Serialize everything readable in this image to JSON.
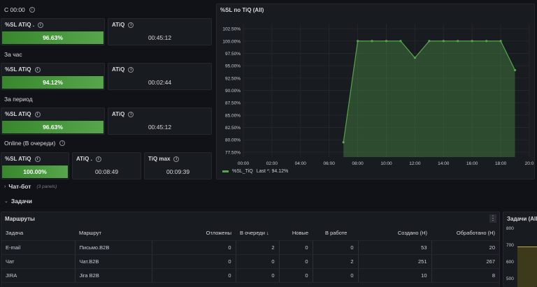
{
  "sections": {
    "s1": "С 00:00",
    "s2": "За час",
    "s3": "За период",
    "s4": "Online (В очереди)"
  },
  "stats": {
    "r1": {
      "sl_title": "%SL ATiQ .",
      "sl_value": "96.63%",
      "sl_fill": 0.9663,
      "at_title": "ATiQ",
      "at_value": "00:45:12"
    },
    "r2": {
      "sl_title": "%SL ATiQ",
      "sl_value": "94.12%",
      "sl_fill": 0.9412,
      "at_title": "ATiQ",
      "at_value": "00:02:44"
    },
    "r3": {
      "sl_title": "%SL ATiQ",
      "sl_value": "96.63%",
      "sl_fill": 0.9663,
      "at_title": "ATiQ",
      "at_value": "00:45:12"
    },
    "r4": {
      "sl_title": "%SL ATiQ",
      "sl_value": "100.00%",
      "sl_fill": 1.0,
      "at_title": "ATiQ .",
      "at_value": "00:08:49",
      "max_title": "TiQ max",
      "max_value": "00:09:39"
    }
  },
  "rows": {
    "chatbot": "Чат-бот",
    "chatbot_note": "(3 panels)",
    "tasks": "Задачи"
  },
  "chart_data": {
    "type": "area",
    "title": "%SL по TiQ (All)",
    "x": [
      "06:50",
      "07:30",
      "08:00",
      "08:30",
      "09:00",
      "09:30",
      "10:00",
      "10:30",
      "11:00",
      "11:30",
      "12:00",
      "12:30",
      "13:00",
      "13:30",
      "14:00",
      "14:30",
      "15:00",
      "15:30",
      "16:00",
      "16:30",
      "17:00",
      "17:30",
      "18:00",
      "18:30",
      "19:00"
    ],
    "x_ticks": [
      "00:00",
      "02:00",
      "04:00",
      "06:00",
      "08:00",
      "10:00",
      "12:00",
      "14:00",
      "16:00",
      "18:00",
      "20:0"
    ],
    "y_ticks": [
      "102.50%",
      "100.00%",
      "97.50%",
      "95.00%",
      "92.50%",
      "90.00%",
      "87.50%",
      "85.00%",
      "82.50%",
      "80.00%",
      "77.50%"
    ],
    "ylim": [
      76.5,
      103.5
    ],
    "xlim_hours": [
      0,
      20
    ],
    "points": [
      [
        7.0,
        79.5
      ],
      [
        8.0,
        100
      ],
      [
        9.0,
        100
      ],
      [
        10.0,
        100
      ],
      [
        11.0,
        100
      ],
      [
        12.0,
        96.6
      ],
      [
        13.0,
        100
      ],
      [
        14.0,
        100
      ],
      [
        15.0,
        100
      ],
      [
        16.0,
        100
      ],
      [
        17.0,
        100
      ],
      [
        18.0,
        100
      ],
      [
        19.0,
        94.1
      ]
    ],
    "series": [
      {
        "name": "%SL_TiQ",
        "legend_extra": "Last *: 94.12%"
      }
    ],
    "color": "#56a64b"
  },
  "table": {
    "title": "Маршруты",
    "columns": [
      "Задача",
      "Маршрут",
      "Отложены",
      "В очереди",
      "Новые",
      "В работе",
      "Создано (Н)",
      "Обработано (Н)"
    ],
    "sort_col_marker": "↓",
    "rows": [
      [
        "E-mail",
        "Письмо.B2B",
        "0",
        "2",
        "0",
        "0",
        "53",
        "20"
      ],
      [
        "Чат",
        "Чат.B2B",
        "0",
        "0",
        "0",
        "2",
        "251",
        "267"
      ],
      [
        "JIRA",
        "Jira B2B",
        "0",
        "0",
        "0",
        "0",
        "10",
        "8"
      ]
    ]
  },
  "right_panel": {
    "title": "Задачи (All)",
    "y_ticks": [
      "800",
      "700",
      "600",
      "500"
    ]
  }
}
